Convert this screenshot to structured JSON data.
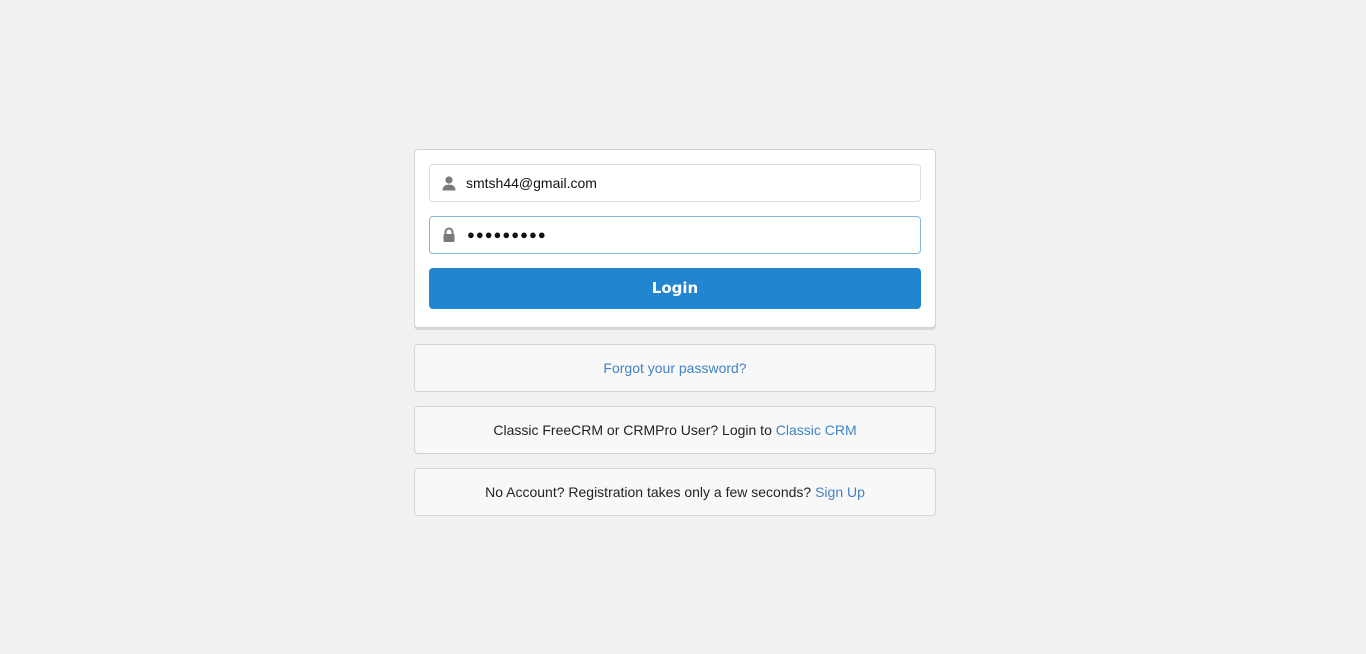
{
  "login_form": {
    "email_value": "smtsh44@gmail.com",
    "password_masked": "●●●●●●●●●",
    "login_label": "Login"
  },
  "links": {
    "forgot_password": "Forgot your password?",
    "classic_text": "Classic FreeCRM or CRMPro User? Login to ",
    "classic_link": "Classic CRM",
    "signup_text": "No Account? Registration takes only a few seconds? ",
    "signup_link": "Sign Up"
  },
  "icons": {
    "email_field": "user-icon",
    "password_field": "lock-icon"
  },
  "colors": {
    "primary_button": "#2185d0",
    "link": "#4183c4",
    "page_background": "#f1f1f1"
  }
}
